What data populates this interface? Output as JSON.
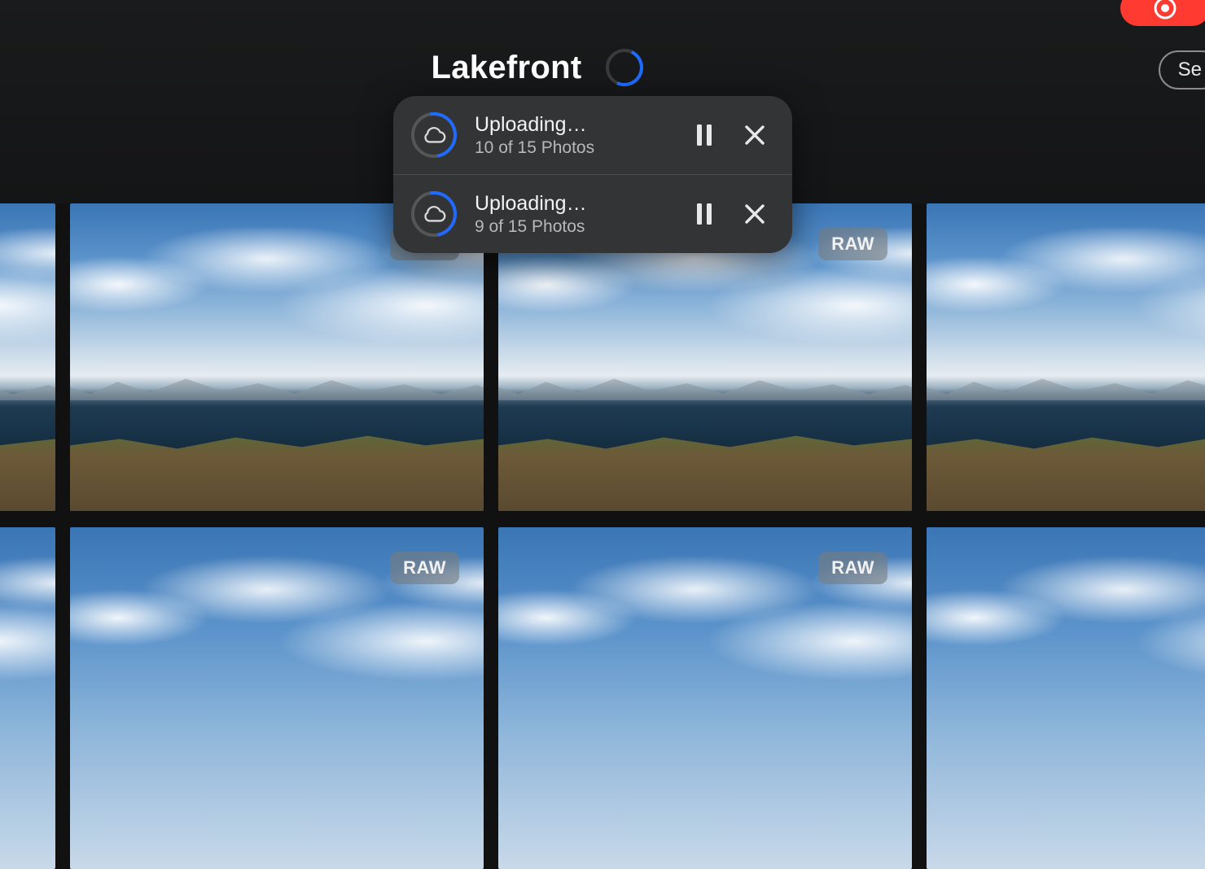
{
  "header": {
    "album_title": "Lakefront",
    "select_label": "Se",
    "sync_progress_fraction": 0.45
  },
  "uploads": [
    {
      "title": "Uploading…",
      "subtitle": "10 of 15 Photos",
      "progress_fraction": 0.42
    },
    {
      "title": "Uploading…",
      "subtitle": "9 of 15 Photos",
      "progress_fraction": 0.38
    }
  ],
  "badges": {
    "raw": "RAW"
  },
  "grid": {
    "rows": [
      {
        "thumbs": [
          {
            "badge": "raw",
            "badge_side": "left"
          },
          {
            "badge": "raw",
            "badge_side": "right"
          },
          {
            "badge": "raw",
            "badge_side": "right"
          },
          {
            "badge": "raw",
            "badge_side": "right"
          }
        ]
      },
      {
        "thumbs": [
          {
            "badge": "raw",
            "badge_side": "left"
          },
          {
            "badge": "raw",
            "badge_side": "right"
          },
          {
            "badge": "raw",
            "badge_side": "right"
          },
          {
            "badge": "raw",
            "badge_side": "right"
          }
        ]
      }
    ]
  },
  "colors": {
    "record_red": "#ff3a30",
    "accent_blue": "#1f6bff",
    "popover_bg": "#333436"
  }
}
